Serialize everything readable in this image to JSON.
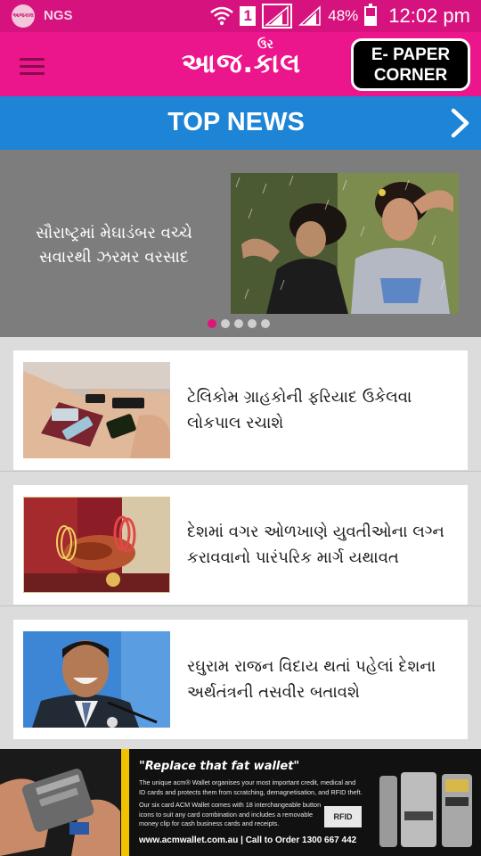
{
  "status_bar": {
    "logo_text": "આજકાલ",
    "carrier": "NGS",
    "sim_slot": "1",
    "battery_percent": "48%",
    "battery_level": 0.48,
    "time": "12:02 pm"
  },
  "header": {
    "logo_text": "આજ.કાલ",
    "logo_mark": "ઉર",
    "epaper_button": {
      "line1": "E- PAPER",
      "line2": "CORNER"
    }
  },
  "top_news": {
    "title": "TOP NEWS"
  },
  "carousel": {
    "headline_line1": "સૌરાષ્ટ્રમાં મેઘાડંબર વચ્ચે",
    "headline_line2": "સવારથી ઝરમર વરસાદ",
    "slide_count": 5,
    "active_index": 0
  },
  "news": [
    {
      "line1": "ટેલિકોમ ગ્રાહકોની ફરિયાદ ઉકેલવા",
      "line2": "લોકપાલ રચાશે",
      "thumb": "hands-with-phones"
    },
    {
      "line1": "દેશમાં વગર ઓળખાણે યુવતીઓના લગ્ન",
      "line2": "કરાવવાનો પારંપરિક માર્ગ યથાવત",
      "thumb": "wedding-hands"
    },
    {
      "line1": "રઘુરામ રાજન વિદાય થતાં પહેલાં દેશના",
      "line2": "અર્થતંત્રની તસવીર બતાવશે",
      "thumb": "man-at-microphone"
    }
  ],
  "ad": {
    "headline": "\"Replace that fat wallet\"",
    "body_lines": [
      "The unique acm® Wallet organises your most important credit, medical and",
      "ID cards and protects them from scratching, demagnetisation, and RFID theft.",
      "Our six card ACM Wallet comes with 18 interchangeable button",
      "icons to suit any card combination and includes a removable",
      "money clip for cash business cards and receipts."
    ],
    "rfid_label": "RFID",
    "footer": "www.acmwallet.com.au  |  Call to Order 1300 667 442"
  },
  "colors": {
    "status_bar": "#d6127e",
    "header": "#ec168c",
    "top_news_bar": "#1d84d6",
    "carousel_bg": "#7d7d7d",
    "active_dot": "#e1127c"
  }
}
